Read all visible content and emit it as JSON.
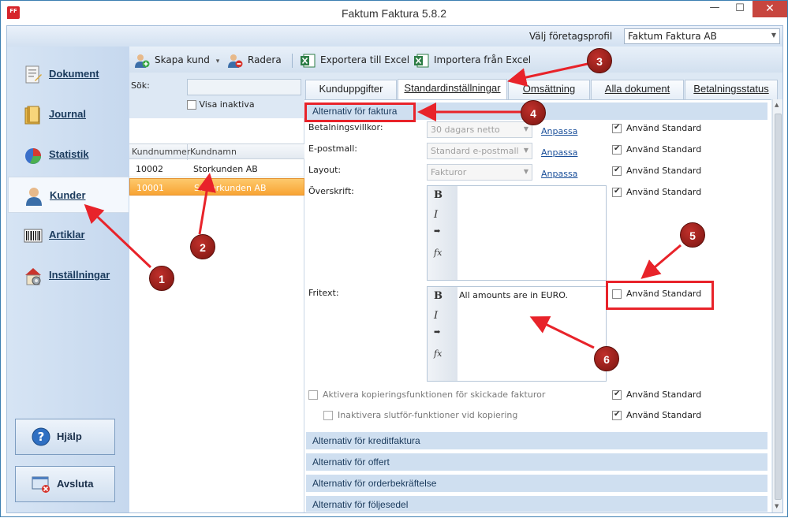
{
  "window": {
    "title": "Faktum Faktura 5.8.2",
    "app_icon": "FF",
    "minimize": "—",
    "maximize": "☐",
    "close": "✕"
  },
  "profile": {
    "label": "Välj företagsprofil",
    "value": "Faktum Faktura AB"
  },
  "nav": {
    "items": [
      {
        "label": "Dokument",
        "icon": "document-icon"
      },
      {
        "label": "Journal",
        "icon": "journal-icon"
      },
      {
        "label": "Statistik",
        "icon": "pie-chart-icon"
      },
      {
        "label": "Kunder",
        "icon": "customer-icon"
      },
      {
        "label": "Artiklar",
        "icon": "barcode-icon"
      },
      {
        "label": "Inställningar",
        "icon": "settings-house-icon"
      }
    ],
    "help": "Hjälp",
    "exit": "Avsluta"
  },
  "toolbar": {
    "create": "Skapa kund",
    "create_arrow": "▾",
    "delete": "Radera",
    "export": "Exportera till Excel",
    "import": "Importera från Excel"
  },
  "search": {
    "label": "Sök:",
    "value": "",
    "show_inactive": "Visa inaktiva"
  },
  "customers": {
    "headers": [
      "Kundnummer",
      "Kundnamn"
    ],
    "rows": [
      {
        "nr": "10002",
        "name": "Storkunden AB"
      },
      {
        "nr": "10001",
        "name": "Superkunden AB"
      }
    ]
  },
  "tabs": [
    "Kunduppgifter",
    "Standardinställningar",
    "Omsättning",
    "Alla dokument",
    "Betalningsstatus"
  ],
  "invoice": {
    "section": "Alternativ för faktura",
    "payment_label": "Betalningsvillkor:",
    "payment_value": "30 dagars netto",
    "email_label": "E-postmall:",
    "email_value": "Standard e-postmall",
    "layout_label": "Layout:",
    "layout_value": "Fakturor",
    "customize": "Anpassa",
    "use_standard": "Använd Standard",
    "header_label": "Överskrift:",
    "free_label": "Fritext:",
    "free_value": "All amounts are in EURO.",
    "copy_opt": "Aktivera kopieringsfunktionen för skickade fakturor",
    "finish_opt": "Inaktivera slutför-funktioner vid kopiering",
    "rte": {
      "bold": "B",
      "italic": "I",
      "indent": "➡",
      "fx": "fx"
    }
  },
  "sections": [
    "Alternativ för kreditfaktura",
    "Alternativ för offert",
    "Alternativ för orderbekräftelse",
    "Alternativ för följesedel"
  ],
  "annotations": [
    "1",
    "2",
    "3",
    "4",
    "5",
    "6"
  ],
  "colors": {
    "annotation": "#a61e1a",
    "arrow": "#e8232a",
    "selected_row": "#f8a434"
  }
}
